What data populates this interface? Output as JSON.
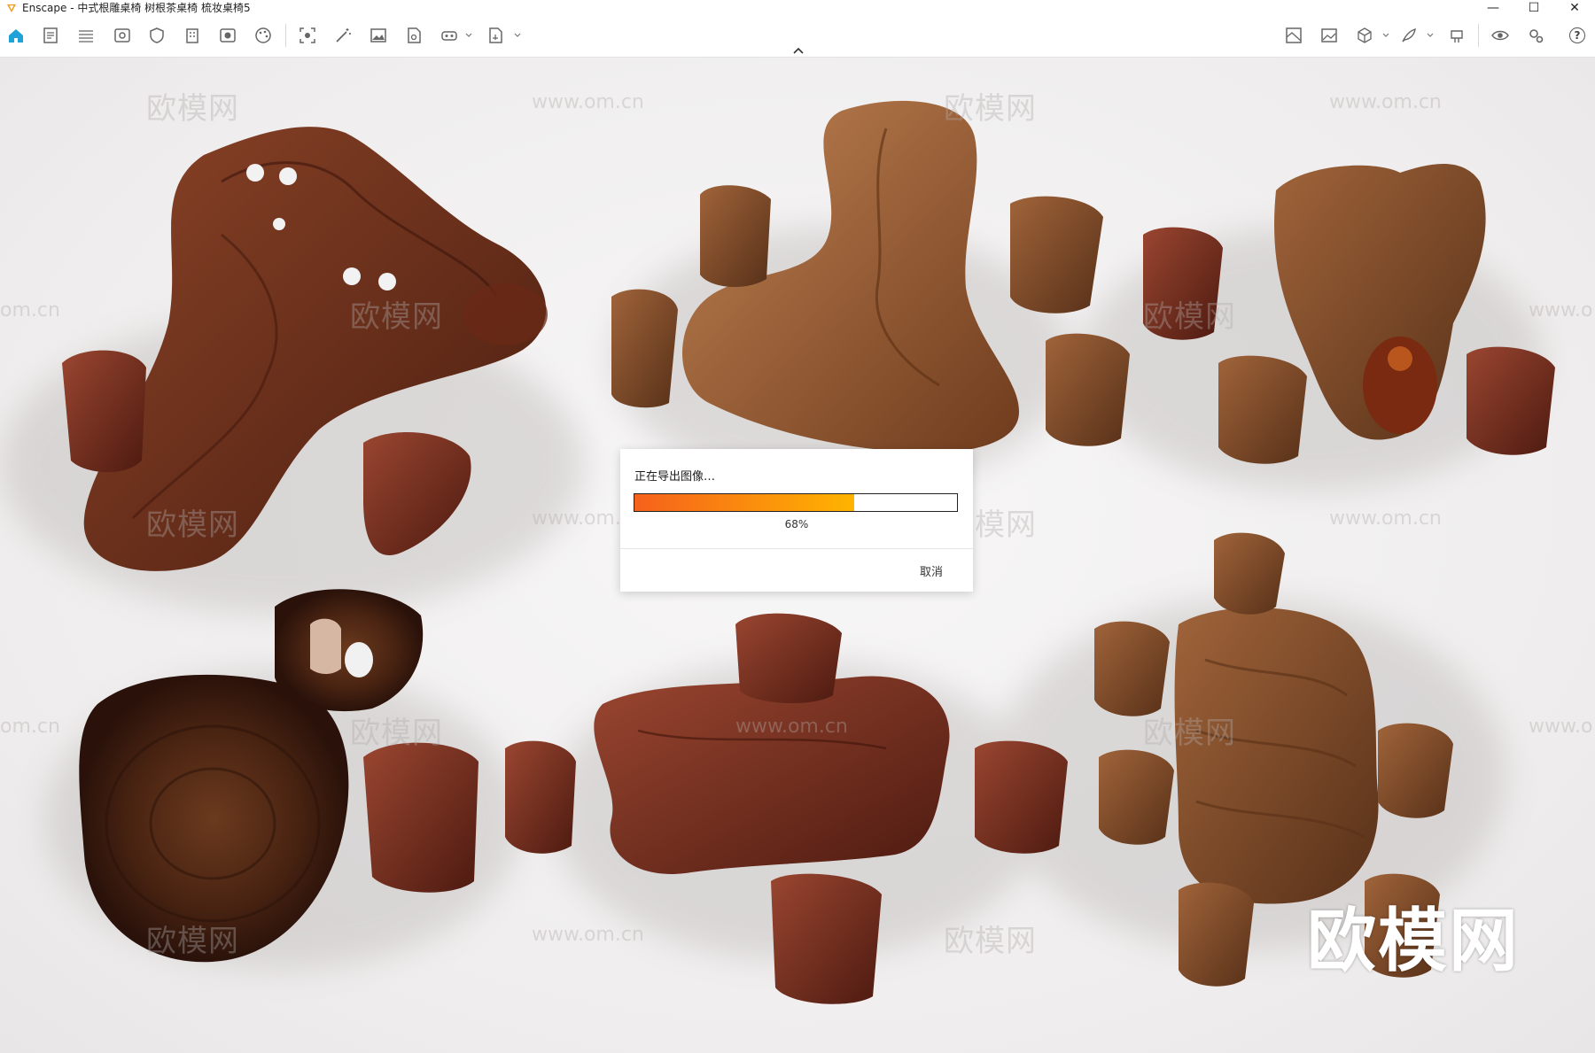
{
  "window": {
    "title": "Enscape - 中式根雕桌椅 树根茶桌椅 梳妆桌椅5",
    "controls": [
      "—",
      "☐",
      "✕"
    ]
  },
  "toolbar": {
    "left_icons": [
      "home-icon",
      "document-icon",
      "bim-icon",
      "view-icon",
      "shield-icon",
      "building-icon",
      "export-icon",
      "palette-icon",
      "capture-icon",
      "magic-wand-icon",
      "image-icon",
      "render-doc-icon",
      "vr-headset-icon",
      "file-export-icon"
    ],
    "right_icons": [
      "map-icon",
      "gallery-icon",
      "cube-icon",
      "feather-icon",
      "live-update-icon",
      "eye-icon",
      "settings-icon",
      "help-icon"
    ],
    "help_label": "?",
    "accent_color": "#1fa2d8"
  },
  "watermarks": {
    "brand": "欧模网",
    "url": "www.om.cn",
    "partial_url": "om.cn",
    "partial_url_right": "www.o"
  },
  "dialog": {
    "title": "正在导出图像…",
    "progress_percent": 68,
    "progress_label": "68%",
    "cancel_label": "取消",
    "progress_colors": [
      "#f5611c",
      "#ffb400"
    ]
  }
}
